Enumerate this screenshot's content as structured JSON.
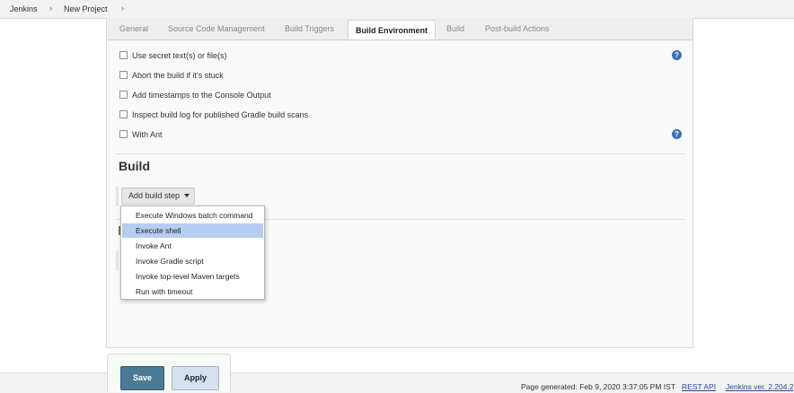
{
  "breadcrumb": {
    "items": [
      "Jenkins",
      "New Project"
    ],
    "separator": "›"
  },
  "tabs": [
    {
      "label": "General",
      "active": false
    },
    {
      "label": "Source Code Management",
      "active": false
    },
    {
      "label": "Build Triggers",
      "active": false
    },
    {
      "label": "Build Environment",
      "active": true
    },
    {
      "label": "Build",
      "active": false
    },
    {
      "label": "Post-build Actions",
      "active": false
    }
  ],
  "build_environment": {
    "options": [
      {
        "label": "Use secret text(s) or file(s)",
        "checked": false
      },
      {
        "label": "Abort the build if it's stuck",
        "checked": false
      },
      {
        "label": "Add timestamps to the Console Output",
        "checked": false
      },
      {
        "label": "Inspect build log for published Gradle build scans",
        "checked": false
      },
      {
        "label": "With Ant",
        "checked": false
      }
    ],
    "help_icon": "?"
  },
  "build": {
    "title": "Build",
    "add_step_label": "Add build step",
    "menu": [
      {
        "label": "Execute Windows batch command",
        "highlighted": false
      },
      {
        "label": "Execute shell",
        "highlighted": true
      },
      {
        "label": "Invoke Ant",
        "highlighted": false
      },
      {
        "label": "Invoke Gradle script",
        "highlighted": false
      },
      {
        "label": "Invoke top-level Maven targets",
        "highlighted": false
      },
      {
        "label": "Run with timeout",
        "highlighted": false
      }
    ]
  },
  "actions": {
    "save_label": "Save",
    "apply_label": "Apply"
  },
  "footer": {
    "generated": "Page generated: Feb 9, 2020 3:37:05 PM IST",
    "rest_api": "REST API",
    "version": "Jenkins ver. 2.204.2"
  },
  "colors": {
    "accent": "#3d6fb6",
    "save_bg": "#4b7a94",
    "menu_highlight": "#b5cdf0"
  }
}
